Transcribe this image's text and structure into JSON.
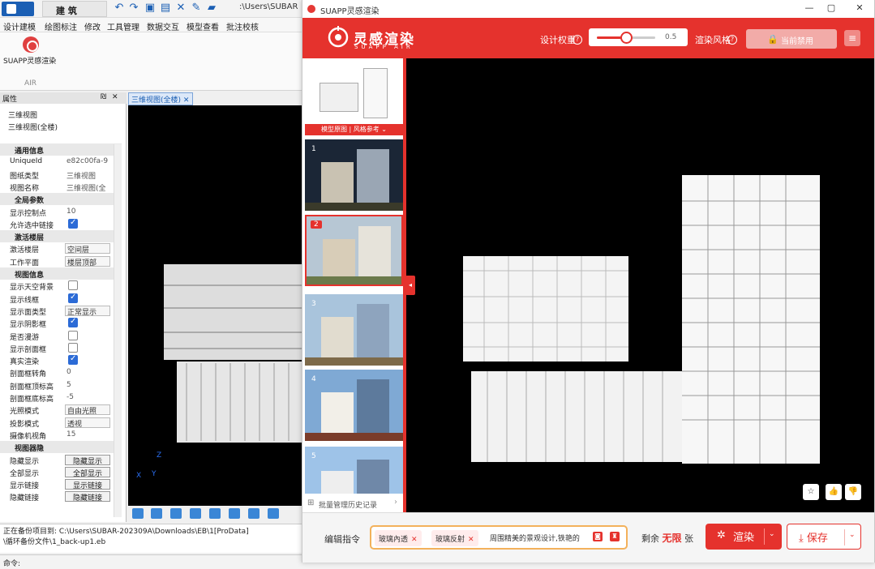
{
  "host": {
    "tab_title": "建 筑",
    "path_text": ":\\Users\\SUBAR",
    "menus": [
      "设计建模",
      "绘图标注",
      "修改",
      "工具管理",
      "数据交互",
      "模型查看",
      "批注校核"
    ],
    "ribbon": {
      "plugin_label": "SUAPP灵感渲染",
      "group_label": "AIR"
    },
    "props": {
      "header": "属性",
      "pin": "₪",
      "close": "✕",
      "view_lines": [
        "三维视图",
        "三维视图(全楼)"
      ],
      "rows": [
        {
          "type": "sec",
          "label": "通用信息"
        },
        {
          "type": "text",
          "label": "UniqueId",
          "value": "e82c00fa-9"
        },
        {
          "type": "text",
          "label": "图纸类型",
          "value": "三维视图"
        },
        {
          "type": "text",
          "label": "视图名称",
          "value": "三维视图(全"
        },
        {
          "type": "sec",
          "label": "全局参数"
        },
        {
          "type": "text",
          "label": "显示控制点",
          "value": "10"
        },
        {
          "type": "check",
          "label": "允许选中链接",
          "value": true
        },
        {
          "type": "sec",
          "label": "激活楼层"
        },
        {
          "type": "select",
          "label": "激活楼层",
          "value": "空间层"
        },
        {
          "type": "select",
          "label": "工作平面",
          "value": "楼层顶部"
        },
        {
          "type": "sec",
          "label": "视图信息"
        },
        {
          "type": "check",
          "label": "显示天空背景",
          "value": false
        },
        {
          "type": "check",
          "label": "显示线框",
          "value": true
        },
        {
          "type": "select",
          "label": "显示面类型",
          "value": "正常显示"
        },
        {
          "type": "check",
          "label": "显示阴影框",
          "value": true
        },
        {
          "type": "check",
          "label": "是否漫游",
          "value": false
        },
        {
          "type": "check",
          "label": "显示剖面框",
          "value": false
        },
        {
          "type": "check",
          "label": "真实渲染",
          "value": true
        },
        {
          "type": "text",
          "label": "剖面框转角",
          "value": "0"
        },
        {
          "type": "text",
          "label": "剖面框顶标高",
          "value": "5"
        },
        {
          "type": "text",
          "label": "剖面框底标高",
          "value": "-5"
        },
        {
          "type": "select",
          "label": "光照模式",
          "value": "自由光照"
        },
        {
          "type": "select",
          "label": "投影模式",
          "value": "透视"
        },
        {
          "type": "text",
          "label": "摄像机视角",
          "value": "15"
        },
        {
          "type": "sec",
          "label": "视图器隐"
        },
        {
          "type": "button",
          "label": "隐藏显示",
          "value": "隐藏显示"
        },
        {
          "type": "button",
          "label": "全部显示",
          "value": "全部显示"
        },
        {
          "type": "button",
          "label": "显示链接",
          "value": "显示链接"
        },
        {
          "type": "button",
          "label": "隐藏链接",
          "value": "隐藏链接"
        }
      ]
    },
    "viewport_tab": "三维视图(全楼)",
    "axis": {
      "z": "Z",
      "x": "X",
      "y": "Y"
    },
    "status_line1": "正在备份项目到: C:\\Users\\SUBAR-202309A\\Downloads\\EB\\1[ProData]",
    "status_line2": "\\循环备份文件\\1_back-up1.eb",
    "command_label": "命令:"
  },
  "plugin": {
    "window_title": "SUAPP灵感渲染",
    "window_controls": {
      "minimize": "—",
      "maximize": "▢",
      "close": "✕"
    },
    "brand_main": "灵感渲染",
    "brand_sub": "SUAPP AIR",
    "weight_label": "设计权重",
    "weight_value": 0.5,
    "weight_text": "0.5",
    "style_label": "渲染风格",
    "style_locked": "当前禁用",
    "help_glyph": "?",
    "lock_glyph": "🔒",
    "menu_glyph": "≡",
    "thumb_original_label": "模型原图 | 风格参考 ⌄",
    "thumbs": [
      "1",
      "2",
      "3",
      "4",
      "5"
    ],
    "selected_thumb": 2,
    "history_label": "批量管理历史记录",
    "history_icon": "⊞",
    "history_arrow": "›",
    "collapse_glyph": "◂",
    "view_actions": {
      "star": "☆",
      "like": "👍",
      "dislike": "👎"
    },
    "command_label": "编辑指令",
    "chips": [
      "玻璃內透",
      "玻璃反射"
    ],
    "chip_close": "✕",
    "prompt_text": "周围精美的景观设计,铁艳的",
    "prompt_btns": [
      "◙",
      "♜"
    ],
    "remaining_prefix": "剩余",
    "remaining_value": "无限",
    "remaining_suffix": "张",
    "render_icon": "✲",
    "render_label": "渲染",
    "save_icon": "⤓",
    "save_label": "保存",
    "dropdown_glyph": "⌄",
    "accent": "#e5322d"
  }
}
